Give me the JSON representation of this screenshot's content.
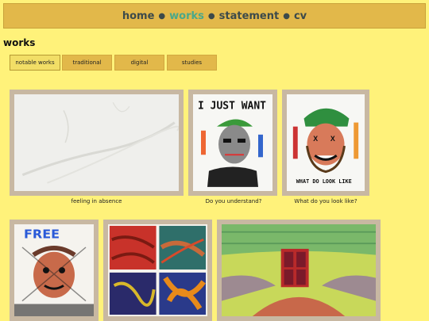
{
  "nav": {
    "items": [
      {
        "label": "home"
      },
      {
        "label": "works"
      },
      {
        "label": "statement"
      },
      {
        "label": "cv"
      }
    ],
    "separator": "●",
    "active": "works"
  },
  "page": {
    "title": "works"
  },
  "filters": [
    {
      "label": "notable works"
    },
    {
      "label": "traditional"
    },
    {
      "label": "digital"
    },
    {
      "label": "studies"
    }
  ],
  "works": [
    {
      "caption": "feeling in absence"
    },
    {
      "caption": "Do you understand?",
      "text": "I JUST WANT TO"
    },
    {
      "caption": "What do you look like?",
      "text": "WHAT DO LOOK LIKE"
    },
    {
      "caption": "",
      "text": "FREE"
    },
    {
      "caption": ""
    },
    {
      "caption": ""
    }
  ],
  "colors": {
    "background": "#fff27a",
    "nav": "#e2b84a",
    "active_link": "#4aa88a",
    "link": "#3c4a4a"
  }
}
